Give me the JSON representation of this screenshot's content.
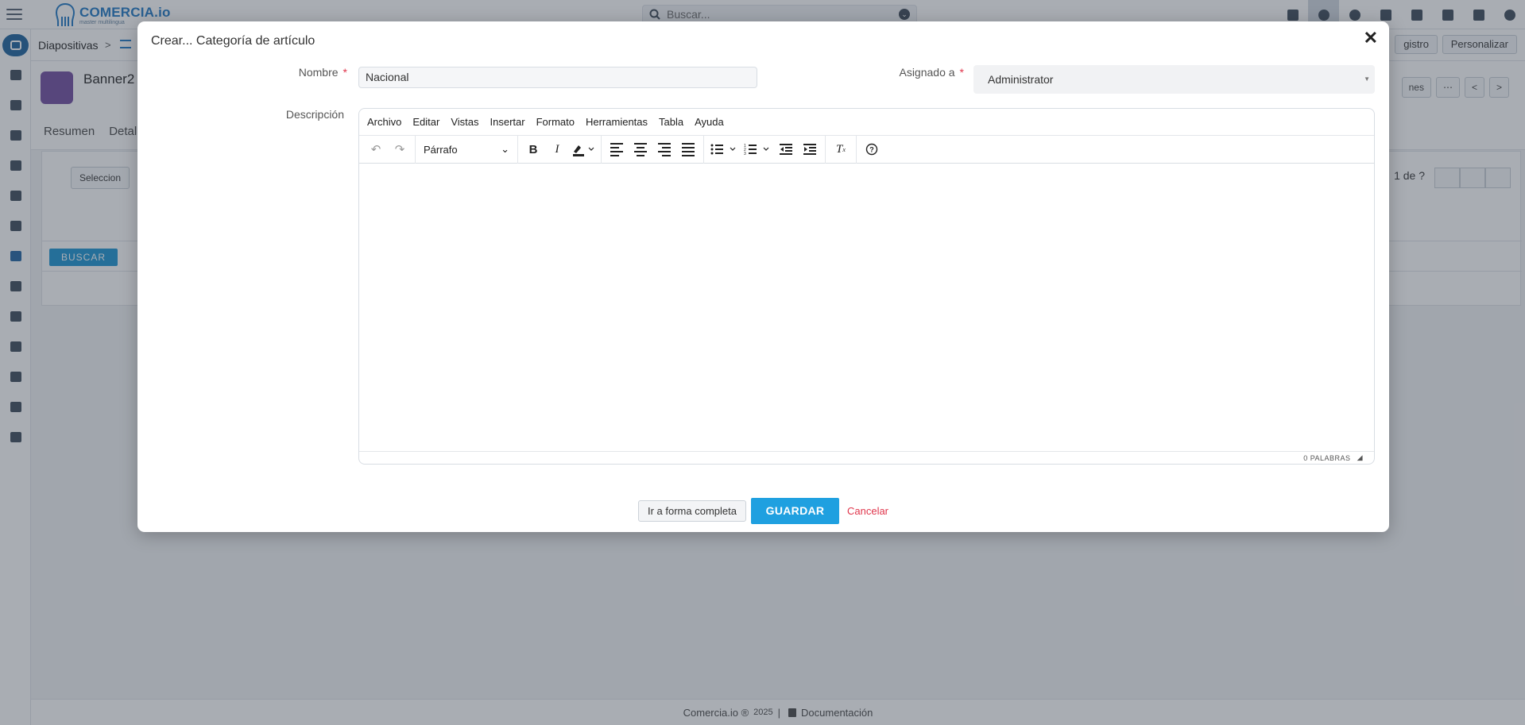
{
  "app": {
    "brand_name": "COMERCIA.io",
    "brand_tagline": "master multilingua",
    "search_placeholder": "Buscar..."
  },
  "breadcrumb": {
    "module": "Diapositivas",
    "separator": ">"
  },
  "header_buttons": {
    "registro": "gistro",
    "personalizar": "Personalizar"
  },
  "record": {
    "title": "Banner2",
    "tabs": [
      "Resumen",
      "Detal"
    ],
    "actions": [
      "nes",
      "⋯",
      "<",
      ">"
    ]
  },
  "panel": {
    "select_label": "Seleccion",
    "buscar_label": "BUSCAR",
    "page_text": "1  de ?"
  },
  "footer": {
    "brand": "Comercia.io ®",
    "year": "2025",
    "divider": "|",
    "docs": "Documentación"
  },
  "modal": {
    "title": "Crear... Categoría de artículo",
    "close_glyph": "✕",
    "fields": {
      "nombre_label": "Nombre",
      "nombre_value": "Nacional",
      "asignado_label": "Asignado a",
      "asignado_value": "Administrator",
      "descripcion_label": "Descripción",
      "required_mark": "*"
    },
    "editor": {
      "menu": [
        "Archivo",
        "Editar",
        "Vistas",
        "Insertar",
        "Formato",
        "Herramientas",
        "Tabla",
        "Ayuda"
      ],
      "block_format": "Párrafo",
      "word_count": "0 PALABRAS"
    },
    "actions": {
      "full_form": "Ir a forma completa",
      "save": "GUARDAR",
      "cancel": "Cancelar"
    }
  },
  "colors": {
    "accent": "#1fa0e0",
    "danger": "#e0364c",
    "brand": "#2f82c8"
  }
}
